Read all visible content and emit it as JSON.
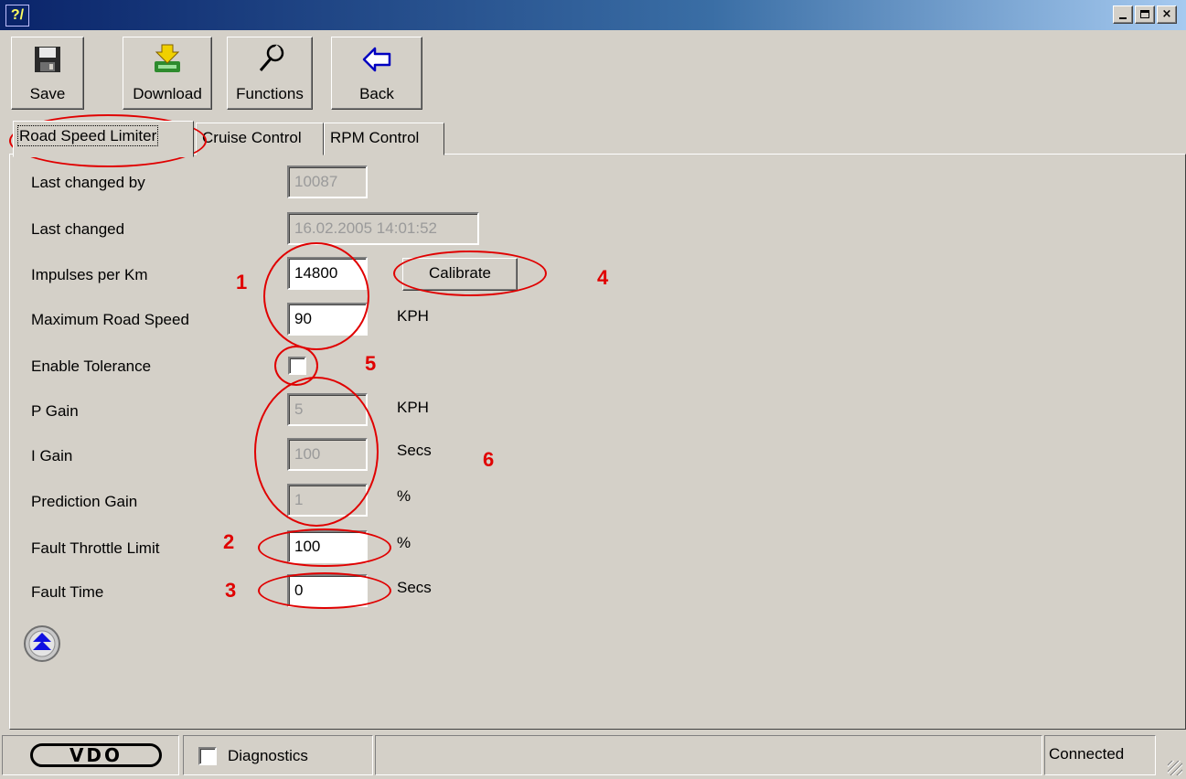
{
  "titlebar": {
    "app_icon_label": "?/",
    "controls": [
      "minimize-icon",
      "maximize-icon",
      "close-icon"
    ],
    "close_glyph": "×"
  },
  "toolbar": {
    "save_label": "Save",
    "download_label": "Download",
    "functions_label": "Functions",
    "back_label": "Back"
  },
  "tabs": [
    {
      "label": "Road Speed Limiter",
      "active": true
    },
    {
      "label": "Cruise Control",
      "active": false
    },
    {
      "label": "RPM Control",
      "active": false
    }
  ],
  "form": {
    "last_changed_by": {
      "label": "Last changed by",
      "value": "10087",
      "enabled": false
    },
    "last_changed": {
      "label": "Last changed",
      "value": "16.02.2005 14:01:52",
      "enabled": false
    },
    "impulses_per_km": {
      "label": "Impulses per Km",
      "value": "14800",
      "enabled": true
    },
    "max_road_speed": {
      "label": "Maximum Road Speed",
      "value": "90",
      "unit": "KPH",
      "enabled": true
    },
    "enable_tolerance": {
      "label": "Enable Tolerance",
      "checked": false
    },
    "p_gain": {
      "label": "P Gain",
      "value": "5",
      "unit": "KPH",
      "enabled": false
    },
    "i_gain": {
      "label": "I Gain",
      "value": "100",
      "unit": "Secs",
      "enabled": false
    },
    "prediction_gain": {
      "label": "Prediction Gain",
      "value": "1",
      "unit": "%",
      "enabled": false
    },
    "fault_throttle_limit": {
      "label": "Fault Throttle Limit",
      "value": "100",
      "unit": "%",
      "enabled": true
    },
    "fault_time": {
      "label": "Fault Time",
      "value": "0",
      "unit": "Secs",
      "enabled": true
    },
    "calibrate_label": "Calibrate"
  },
  "annotations": [
    "1",
    "2",
    "3",
    "4",
    "5",
    "6"
  ],
  "annotation_color": "#e00000",
  "statusbar": {
    "logo_text": "VDO",
    "diagnostics_label": "Diagnostics",
    "diagnostics_checked": false,
    "status_text": "Connected"
  },
  "colors": {
    "title_gradient_start": "#0a246a",
    "face": "#d4d0c8"
  }
}
